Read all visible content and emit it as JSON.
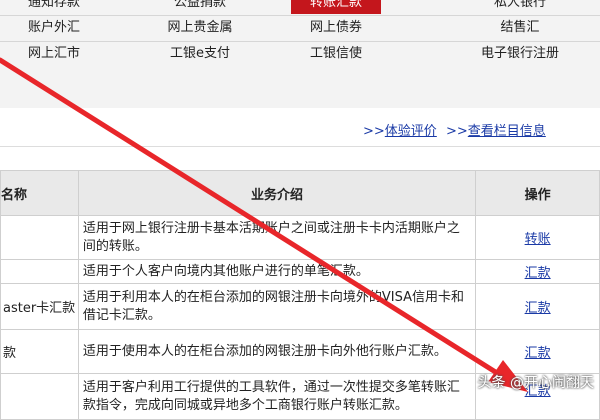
{
  "menu": {
    "row1": [
      "通知存款",
      "公益捐款",
      "转账汇款",
      "私人银行"
    ],
    "row2": [
      "账户外汇",
      "网上贵金属",
      "网上债券",
      "结售汇"
    ],
    "row3": [
      "网上汇市",
      "工银e支付",
      "工银信使",
      "电子银行注册"
    ]
  },
  "links": {
    "experience_arrow": ">>",
    "experience": "体验评价",
    "column_arrow": ">>",
    "column": "查看栏目信息"
  },
  "table": {
    "headers": [
      "名称",
      "业务介绍",
      "操作"
    ],
    "rows": [
      {
        "name": "",
        "desc": "适用于网上银行注册卡基本活期账户之间或注册卡卡内活期账户之间的转账。",
        "action": "转账"
      },
      {
        "name": "",
        "desc": "适用于个人客户向境内其他账户进行的单笔汇款。",
        "action": "汇款"
      },
      {
        "name": "aster卡汇款",
        "desc": "适用于利用本人的在柜台添加的网银注册卡向境外的VISA信用卡和借记卡汇款。",
        "action": "汇款"
      },
      {
        "name": "款",
        "desc": "适用于使用本人的在柜台添加的网银注册卡向外他行账户汇款。",
        "action": "汇款"
      },
      {
        "name": "",
        "desc": "适用于客户利用工行提供的工具软件，通过一次性提交多笔转账汇款指令，完成向同城或异地多个工商银行账户转账汇款。",
        "action": "汇款"
      }
    ]
  },
  "watermark": "头条 @开心闹翻天",
  "colors": {
    "active_tab": "#c4161c",
    "link": "#1a3aa6",
    "arrow": "#e8262a"
  }
}
